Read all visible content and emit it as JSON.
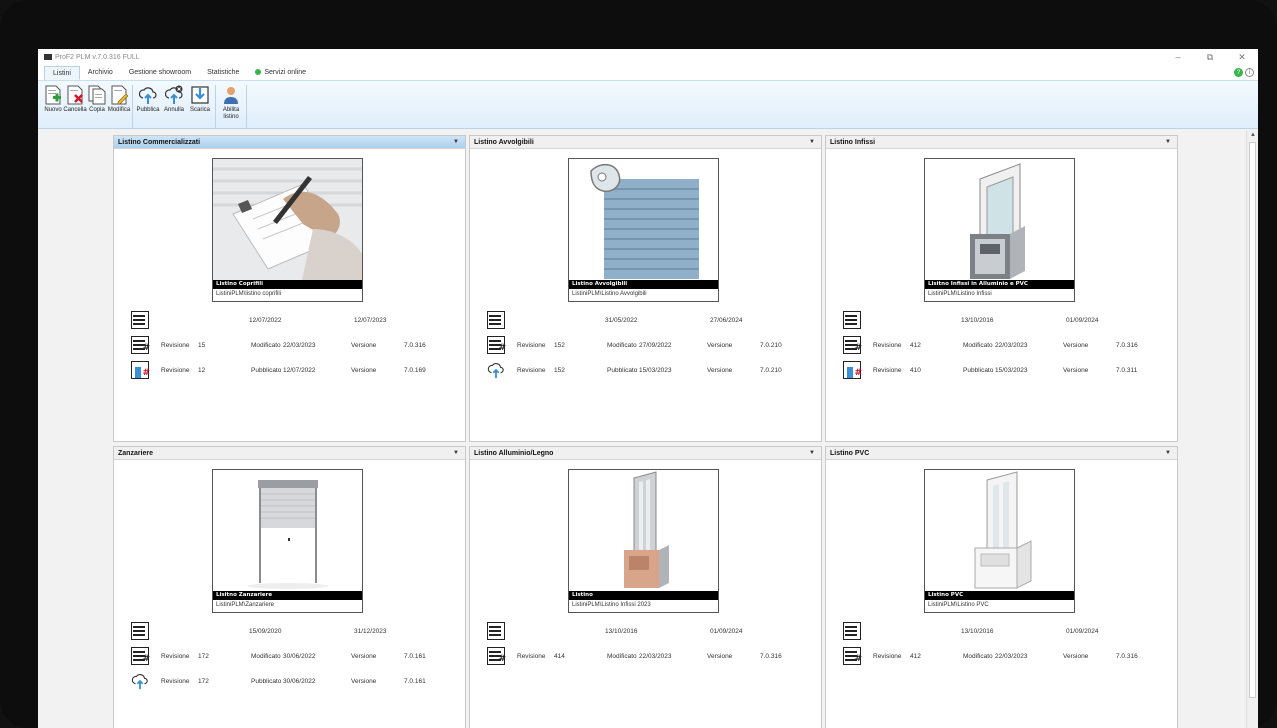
{
  "window": {
    "title": "ProF2 PLM  v.7.0.316 FULL",
    "controls": {
      "minimize": "–",
      "restore": "⧉",
      "close": "✕"
    }
  },
  "menu": {
    "tabs": [
      "Listini",
      "Archivio",
      "Gestione showroom",
      "Statistiche"
    ],
    "online": "Servizi online",
    "online_color": "#38b44a"
  },
  "ribbon": {
    "group1": [
      {
        "label": "Nuovo",
        "icon": "new-document-icon"
      },
      {
        "label": "Cancella",
        "icon": "delete-document-icon"
      },
      {
        "label": "Copia",
        "icon": "copy-document-icon"
      },
      {
        "label": "Modifica",
        "icon": "edit-document-icon"
      }
    ],
    "group2": [
      {
        "label": "Pubblica",
        "icon": "cloud-upload-icon"
      },
      {
        "label": "Annulla",
        "icon": "cloud-cancel-icon"
      },
      {
        "label": "Scarica",
        "icon": "download-icon"
      }
    ],
    "group3": [
      {
        "label": "Abilita listino",
        "icon": "user-icon"
      }
    ]
  },
  "panels": [
    {
      "title": "Listino Commercializzati",
      "card_title": "Listino Coprifili",
      "card_path": "ListiniPLM\\listino coprifili",
      "image": "document-signing-photo",
      "created": "12/07/2022",
      "updated": "12/07/2023",
      "modified": {
        "rev_label": "Revisione",
        "rev": "15",
        "label": "Modificato",
        "date": "22/03/2023",
        "ver_label": "Versione",
        "ver": "7.0.316"
      },
      "published": {
        "rev_label": "Revisione",
        "rev": "12",
        "label": "Pubblicato",
        "date": "12/07/2022",
        "ver_label": "Versione",
        "ver": "7.0.169"
      },
      "published_icon": "publish-hash-icon"
    },
    {
      "title": "Listino Avvolgibili",
      "card_title": "Listino Avvolgibili",
      "card_path": "ListiniPLM\\Listino Avvolgibili",
      "image": "roller-shutter-image",
      "created": "31/05/2022",
      "updated": "27/06/2024",
      "modified": {
        "rev_label": "Revisione",
        "rev": "152",
        "label": "Modificato",
        "date": "27/09/2022",
        "ver_label": "Versione",
        "ver": "7.0.210"
      },
      "published": {
        "rev_label": "Revisione",
        "rev": "152",
        "label": "Pubblicato",
        "date": "15/03/2023",
        "ver_label": "Versione",
        "ver": "7.0.210"
      },
      "published_icon": "cloud-upload-icon"
    },
    {
      "title": "Listino Infissi",
      "card_title": "Lisitno Infissi in Alluminio e PVC",
      "card_path": "ListiniPLM\\Listino Infissi",
      "image": "window-profile-image",
      "created": "13/10/2016",
      "updated": "01/09/2024",
      "modified": {
        "rev_label": "Revisione",
        "rev": "412",
        "label": "Modificato",
        "date": "22/03/2023",
        "ver_label": "Versione",
        "ver": "7.0.316"
      },
      "published": {
        "rev_label": "Revisione",
        "rev": "410",
        "label": "Pubblicato",
        "date": "15/03/2023",
        "ver_label": "Versione",
        "ver": "7.0.311"
      },
      "published_icon": "publish-hash-icon"
    },
    {
      "title": "Zanzariere",
      "card_title": "Lisitno Zanzariere",
      "card_path": "ListiniPLM\\Zanzariere",
      "image": "mosquito-net-image",
      "created": "15/09/2020",
      "updated": "31/12/2023",
      "modified": {
        "rev_label": "Revisione",
        "rev": "172",
        "label": "Modificato",
        "date": "30/06/2022",
        "ver_label": "Versione",
        "ver": "7.0.161"
      },
      "published": {
        "rev_label": "Revisione",
        "rev": "172",
        "label": "Pubblicato",
        "date": "30/06/2022",
        "ver_label": "Versione",
        "ver": "7.0.161"
      },
      "published_icon": "cloud-upload-icon"
    },
    {
      "title": "Listino Alluminio/Legno",
      "card_title": "Listino",
      "card_path": "ListiniPLM\\Listino Infissi 2023",
      "image": "wood-aluminium-profile-image",
      "created": "13/10/2016",
      "updated": "01/09/2024",
      "modified": {
        "rev_label": "Revisione",
        "rev": "414",
        "label": "Modificato",
        "date": "22/03/2023",
        "ver_label": "Versione",
        "ver": "7.0.316"
      },
      "published": null
    },
    {
      "title": "Listino PVC",
      "card_title": "Listino PVC",
      "card_path": "ListiniPLM\\Listino PVC",
      "image": "pvc-profile-image",
      "created": "13/10/2016",
      "updated": "01/09/2024",
      "modified": {
        "rev_label": "Revisione",
        "rev": "412",
        "label": "Modificato",
        "date": "22/03/2023",
        "ver_label": "Versione",
        "ver": "7.0.316"
      },
      "published": null
    }
  ],
  "colors": {
    "accent": "#a9cfee",
    "ribbon": "#dfeefb",
    "publish_blue": "#3a8fd6",
    "hash_red": "#d3162e"
  }
}
